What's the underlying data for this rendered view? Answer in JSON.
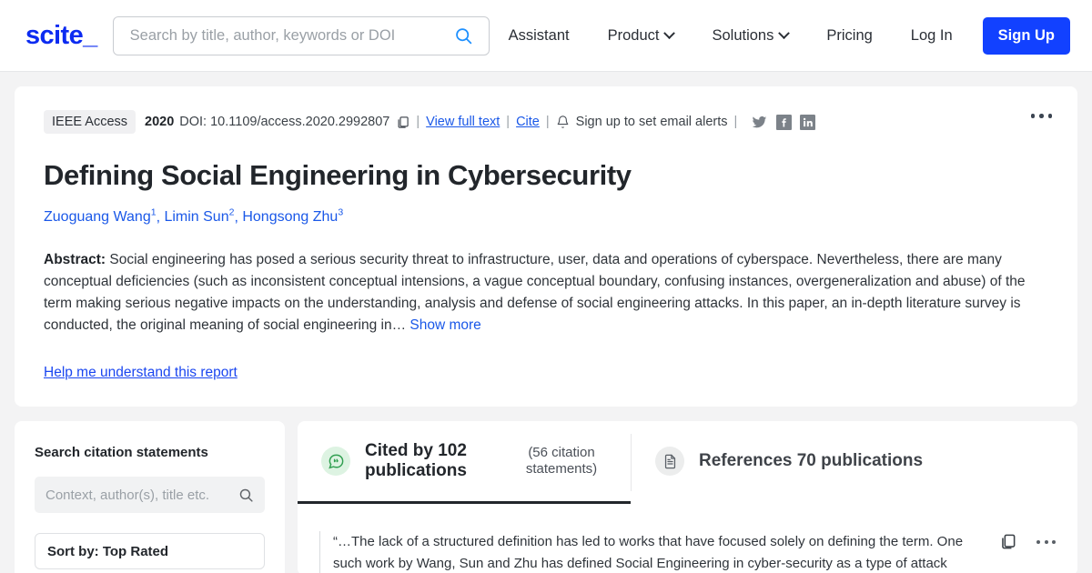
{
  "header": {
    "logo": "scite_",
    "search": {
      "placeholder": "Search by title, author, keywords or DOI",
      "value": "",
      "icon": "search-icon"
    },
    "nav": [
      {
        "label": "Assistant",
        "caret": false
      },
      {
        "label": "Product",
        "caret": true
      },
      {
        "label": "Solutions",
        "caret": true
      },
      {
        "label": "Pricing",
        "caret": false
      },
      {
        "label": "Log In",
        "caret": false
      }
    ],
    "signup_label": "Sign Up"
  },
  "paper": {
    "journal": "IEEE Access",
    "year": "2020",
    "doi": "DOI: 10.1109/access.2020.2992807",
    "copy_icon": "copy-icon",
    "view_full_text": "View full text",
    "cite": "Cite",
    "bell_icon": "bell-icon",
    "email_alerts": "Sign up to set email alerts",
    "social": [
      "twitter-icon",
      "facebook-icon",
      "linkedin-icon"
    ],
    "title": "Defining Social Engineering in Cybersecurity",
    "authors": [
      {
        "name": "Zuoguang Wang",
        "sup": "1"
      },
      {
        "name": "Limin Sun",
        "sup": "2"
      },
      {
        "name": "Hongsong Zhu",
        "sup": "3"
      }
    ],
    "abstract_label": "Abstract:",
    "abstract_text": "Social engineering has posed a serious security threat to infrastructure, user, data and operations of cyberspace. Nevertheless, there are many conceptual deficiencies (such as inconsistent conceptual intensions, a vague conceptual boundary, confusing instances, overgeneralization and abuse) of the term making serious negative impacts on the understanding, analysis and defense of social engineering attacks. In this paper, an in-depth literature survey is conducted, the original meaning of social engineering in…",
    "show_more": "Show more",
    "help_link": "Help me understand this report"
  },
  "sidebar": {
    "title": "Search citation statements",
    "search_placeholder": "Context, author(s), title etc.",
    "search_value": "",
    "search_icon": "search-icon",
    "sort_label": "Sort by: Top Rated"
  },
  "tabs": [
    {
      "icon": "quote-bubble-icon",
      "label": "Cited by 102 publications",
      "sub": "(56 citation statements)",
      "active": true
    },
    {
      "icon": "document-icon",
      "label": "References 70 publications",
      "sub": "",
      "active": false
    }
  ],
  "statements": [
    {
      "text": "“…The lack of a structured definition has led to works that have focused solely on defining the term. One such work by Wang, Sun and Zhu has defined Social Engineering in cyber-security as a type of attack",
      "copy_icon": "copy-icon",
      "more_icon": "more-icon"
    }
  ],
  "colors": {
    "brand_blue": "#0c2bf1",
    "link_blue": "#1a58e8",
    "signup_blue": "#1241ff",
    "page_bg": "#f3f3f4",
    "text_dark": "#22262b",
    "green_accent": "#2f9e4f"
  }
}
